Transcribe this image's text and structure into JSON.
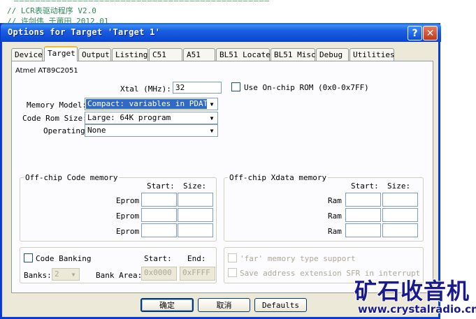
{
  "editor": {
    "line1": "//   LCR表驱动程序 V2.0",
    "line2": "//   许剑伟 于莆田 2012.01"
  },
  "window": {
    "title": "Options for Target 'Target 1'",
    "help_label": "?",
    "close_label": "✕"
  },
  "tabs": [
    {
      "label": "Device"
    },
    {
      "label": "Target"
    },
    {
      "label": "Output"
    },
    {
      "label": "Listing"
    },
    {
      "label": "C51"
    },
    {
      "label": "A51"
    },
    {
      "label": "BL51 Locate"
    },
    {
      "label": "BL51 Misc"
    },
    {
      "label": "Debug"
    },
    {
      "label": "Utilities"
    }
  ],
  "target": {
    "device_name": "Atmel AT89C2051",
    "xtal_label": "Xtal (MHz):",
    "xtal_value": "32",
    "onchip_rom_label": "Use On-chip ROM (0x0-0x7FF)",
    "onchip_rom_checked": false,
    "memory_model_label": "Memory Model:",
    "memory_model_value": "Compact: variables in PDATA",
    "code_rom_label": "Code Rom Size:",
    "code_rom_value": "Large: 64K program",
    "operating_label": "Operating",
    "operating_value": "None"
  },
  "offchip_code": {
    "title": "Off-chip Code memory",
    "start_header": "Start:",
    "size_header": "Size:",
    "rows": [
      {
        "label": "Eprom",
        "start": "",
        "size": ""
      },
      {
        "label": "Eprom",
        "start": "",
        "size": ""
      },
      {
        "label": "Eprom",
        "start": "",
        "size": ""
      }
    ]
  },
  "offchip_xdata": {
    "title": "Off-chip Xdata memory",
    "start_header": "Start:",
    "size_header": "Size:",
    "rows": [
      {
        "label": "Ram",
        "start": "",
        "size": ""
      },
      {
        "label": "Ram",
        "start": "",
        "size": ""
      },
      {
        "label": "Ram",
        "start": "",
        "size": ""
      }
    ]
  },
  "banking": {
    "code_banking_label": "Code Banking",
    "start_header": "Start:",
    "end_header": "End:",
    "banks_label": "Banks:",
    "banks_value": "2",
    "bank_area_label": "Bank Area:",
    "bank_area_start": "0x0000",
    "bank_area_end": "0xFFFF"
  },
  "far_options": {
    "far_memory_label": "'far' memory type support",
    "save_ext_label": "Save address extension SFR in interrupt"
  },
  "buttons": {
    "ok_label": "确定",
    "cancel_label": "取消",
    "defaults_label": "Defaults"
  },
  "watermark": {
    "text": "矿石收音机",
    "url": "www.crystalradio.cn"
  }
}
